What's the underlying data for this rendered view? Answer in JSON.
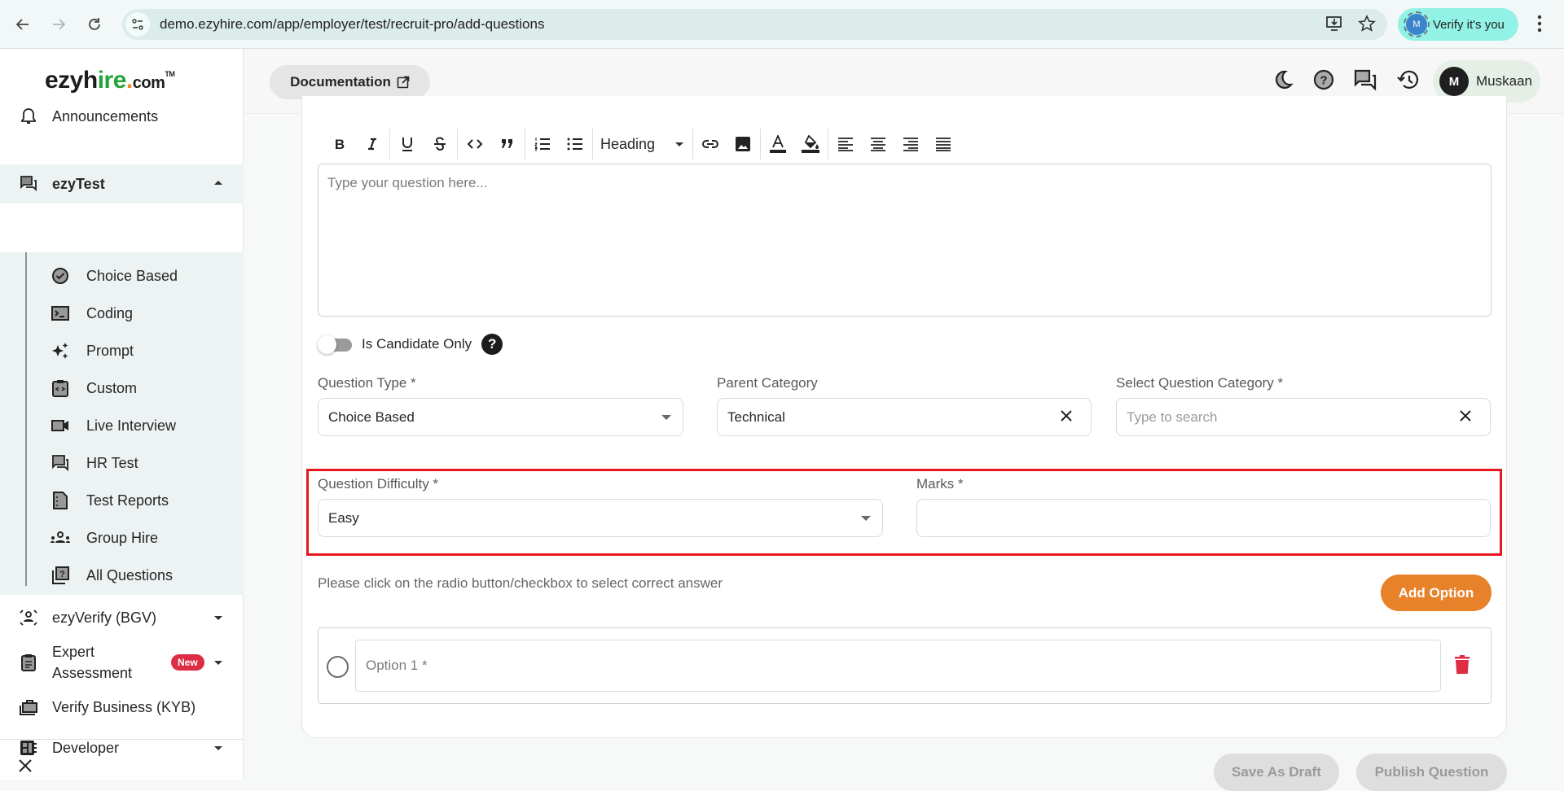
{
  "browser": {
    "url": "demo.ezyhire.com/app/employer/test/recruit-pro/add-questions",
    "verify_label": "Verify it's you",
    "verify_avatar": "M",
    "icons": [
      "back-icon",
      "forward-icon",
      "reload-icon",
      "site-settings-icon",
      "install-app-icon",
      "bookmark-star-icon",
      "more-menu-icon"
    ]
  },
  "sidebar": {
    "logo": {
      "part1": "ezyh",
      "part2": "ir",
      "part3": "e",
      "dot": ".",
      "com": "com",
      "tm": "TM"
    },
    "items": [
      {
        "label": "Announcements",
        "icon": "bell-icon"
      },
      {
        "label": "ezyTest",
        "icon": "forum-icon",
        "expanded": true,
        "active": true
      },
      {
        "label": "ezyVerify (BGV)",
        "icon": "verify-person-icon"
      },
      {
        "label": "Expert Assessment",
        "line1": "Expert",
        "line2": "Assessment",
        "icon": "clipboard-icon",
        "badge": "New"
      },
      {
        "label": "Verify Business (KYB)",
        "icon": "briefcase-icon"
      },
      {
        "label": "Developer",
        "icon": "developer-board-icon"
      }
    ],
    "subitems": [
      {
        "label": "Choice Based",
        "icon": "check-circle-icon"
      },
      {
        "label": "Coding",
        "icon": "terminal-icon"
      },
      {
        "label": "Prompt",
        "icon": "sparkles-icon"
      },
      {
        "label": "Custom",
        "icon": "code-clipboard-icon"
      },
      {
        "label": "Live Interview",
        "icon": "video-camera-icon"
      },
      {
        "label": "HR Test",
        "icon": "chat-icon"
      },
      {
        "label": "Test Reports",
        "icon": "report-icon"
      },
      {
        "label": "Group Hire",
        "icon": "group-icon"
      },
      {
        "label": "All Questions",
        "icon": "question-library-icon"
      }
    ]
  },
  "header": {
    "documentation_label": "Documentation",
    "icons": [
      "dark-mode-icon",
      "help-icon",
      "chat-icon",
      "history-icon"
    ],
    "user": {
      "initial": "M",
      "name": "Muskaan"
    }
  },
  "editor": {
    "toolbar": {
      "heading_label": "Heading",
      "buttons": [
        "bold",
        "italic",
        "underline",
        "strikethrough",
        "code",
        "blockquote",
        "ordered-list",
        "bullet-list",
        "link",
        "image",
        "text-color",
        "highlight-color",
        "align-left",
        "align-center",
        "align-right",
        "align-justify"
      ]
    },
    "placeholder": "Type your question here..."
  },
  "form": {
    "candidate_only_label": "Is Candidate Only",
    "candidate_only": false,
    "question_type": {
      "label": "Question Type *",
      "value": "Choice Based"
    },
    "parent_category": {
      "label": "Parent Category",
      "value": "Technical"
    },
    "question_category": {
      "label": "Select Question Category *",
      "placeholder": "Type to search",
      "value": ""
    },
    "difficulty": {
      "label": "Question Difficulty *",
      "value": "Easy"
    },
    "marks": {
      "label": "Marks *",
      "value": ""
    },
    "hint": "Please click on the radio button/checkbox to select correct answer",
    "add_option_label": "Add Option",
    "options": [
      {
        "placeholder": "Option 1 *",
        "value": "",
        "selected": false
      }
    ]
  },
  "actions": {
    "save_draft_label": "Save As Draft",
    "publish_label": "Publish Question"
  },
  "colors": {
    "accent_orange": "#e7812a",
    "highlight_red": "#e8161d",
    "delete_red": "#dc2d45",
    "badge_red": "#dc2d45",
    "brand_green": "#22a53a"
  }
}
